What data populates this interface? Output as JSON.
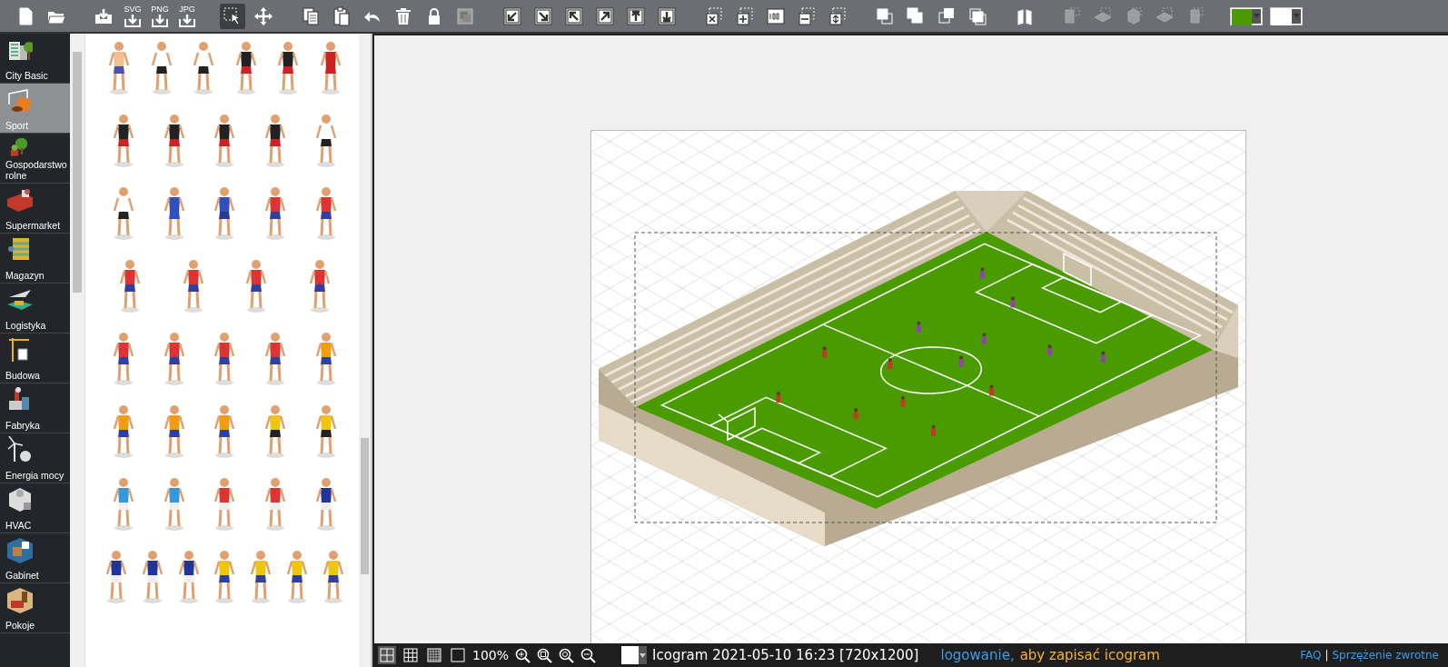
{
  "toolbar": {
    "export_labels": [
      "SVG",
      "PNG",
      "JPG"
    ],
    "pointer_tools": [
      {
        "selected": true
      },
      {
        "selected": false
      }
    ],
    "swatches": [
      {
        "color": "#4c9a00"
      },
      {
        "color": "#ffffff"
      }
    ]
  },
  "categories": [
    {
      "label": "City Basic",
      "selected": false
    },
    {
      "label": "Sport",
      "selected": true
    },
    {
      "label": "Gospodarstwo rolne",
      "selected": false
    },
    {
      "label": "Supermarket",
      "selected": false
    },
    {
      "label": "Magazyn",
      "selected": false
    },
    {
      "label": "Logistyka",
      "selected": false
    },
    {
      "label": "Budowa",
      "selected": false
    },
    {
      "label": "Fabryka",
      "selected": false
    },
    {
      "label": "Energia mocy",
      "selected": false
    },
    {
      "label": "HVAC",
      "selected": false
    },
    {
      "label": "Gabinet",
      "selected": false
    },
    {
      "label": "Pokoje",
      "selected": false
    }
  ],
  "status_bar": {
    "grid_modes": [
      {
        "selected": true
      },
      {
        "selected": false
      },
      {
        "selected": false
      },
      {
        "selected": false
      }
    ],
    "zoom": "100%",
    "document": "Icogram 2021-05-10 16:23 [720x1200]",
    "login_link": "logowanie,",
    "login_hint": "aby zapisać icogram",
    "faq_link": "FAQ",
    "separator": "|",
    "feedback_link": "Sprzężenie zwrotne"
  }
}
